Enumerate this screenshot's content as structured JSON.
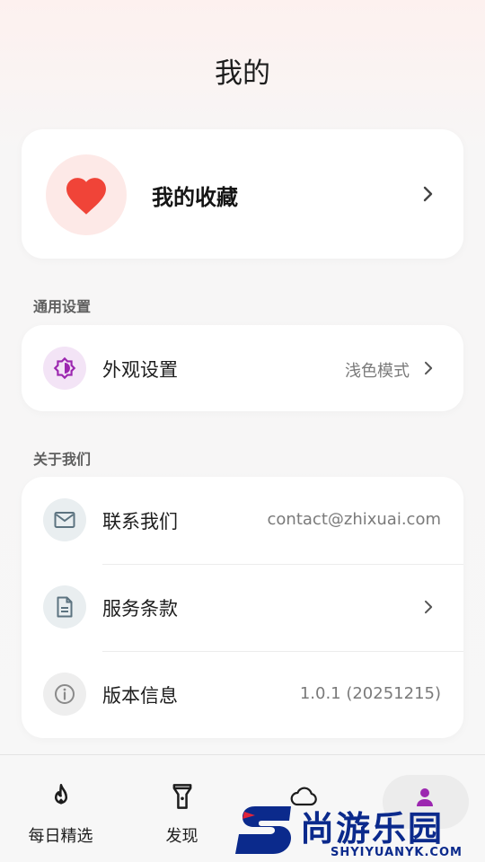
{
  "header": {
    "title": "我的"
  },
  "favorites": {
    "label": "我的收藏",
    "icon": "heart-icon",
    "accent": "#f04438"
  },
  "sections": {
    "general": {
      "label": "通用设置",
      "appearance": {
        "label": "外观设置",
        "value": "浅色模式",
        "icon": "brightness-icon",
        "accent": "#9c27b0"
      }
    },
    "about": {
      "label": "关于我们",
      "contact": {
        "label": "联系我们",
        "value": "contact@zhixuai.com",
        "icon": "mail-icon"
      },
      "terms": {
        "label": "服务条款",
        "icon": "document-icon"
      },
      "version": {
        "label": "版本信息",
        "value": "1.0.1 (20251215)",
        "icon": "info-icon"
      }
    }
  },
  "bottom_nav": {
    "items": [
      {
        "label": "每日精选",
        "icon": "flame-icon"
      },
      {
        "label": "发现",
        "icon": "flashlight-icon"
      },
      {
        "label": "",
        "icon": "cloud-icon"
      },
      {
        "label": "",
        "icon": "person-icon",
        "active": true
      }
    ]
  },
  "watermark": {
    "text": "尚游乐园",
    "sub": "SHYIYUANYK.COM"
  }
}
